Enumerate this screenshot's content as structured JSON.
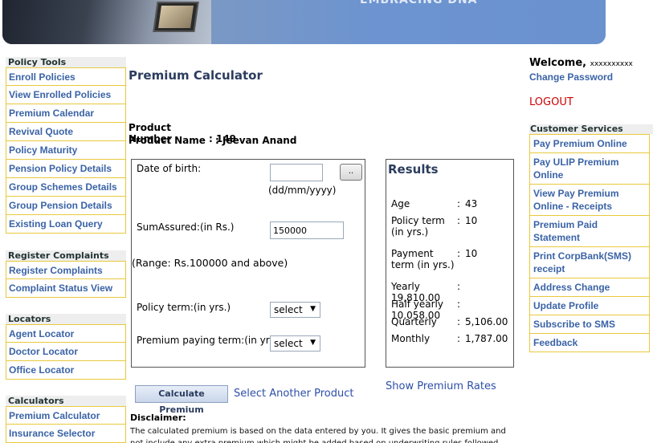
{
  "banner": {
    "tag": "EMBRACING DNA"
  },
  "left_nav": {
    "sections": [
      {
        "heading": "Policy Tools",
        "items": [
          "Enroll Policies",
          "View Enrolled Policies",
          "Premium Calendar",
          "Revival Quote",
          "Policy Maturity",
          "Pension Policy Details",
          "Group Schemes Details",
          "Group Pension Details",
          "Existing Loan Query"
        ]
      },
      {
        "heading": "Register Complaints",
        "items": [
          "Register Complaints",
          "Complaint Status View"
        ]
      },
      {
        "heading": "Locators",
        "items": [
          "Agent Locator",
          "Doctor Locator",
          "Office Locator"
        ]
      },
      {
        "heading": "Calculators",
        "items": [
          "Premium Calculator",
          "Insurance Selector"
        ]
      }
    ]
  },
  "main": {
    "title": "Premium Calculator",
    "product_number_label": "Product Number",
    "product_number": ": 149",
    "product_name_label": "Product Name",
    "product_name": ": Jeevan Anand"
  },
  "form": {
    "dob_label": "Date of birth:",
    "dob_value": "",
    "dob_button": "..",
    "dob_hint": "(dd/mm/yyyy)",
    "sum_label": "SumAssured:(in Rs.)",
    "sum_value": "150000",
    "range_note": "(Range: Rs.100000 and above)",
    "policy_term_label": "Policy term:(in yrs.)",
    "policy_term_value": "select",
    "premium_term_label": "Premium paying term:(in yrs.)",
    "premium_term_value": "select"
  },
  "results": {
    "title": "Results",
    "rows": [
      {
        "key": "Age",
        "value": "43"
      },
      {
        "key": "Policy term (in yrs.)",
        "value": "10"
      },
      {
        "key": "Payment term (in yrs.)",
        "value": "10"
      },
      {
        "key": "Yearly",
        "value": "19,810.00"
      },
      {
        "key": "Half yearly",
        "value": "10,058.00"
      },
      {
        "key": "Quarterly",
        "value": "5,106.00"
      },
      {
        "key": "Monthly",
        "value": "1,787.00"
      }
    ]
  },
  "actions": {
    "calculate": "Calculate Premium",
    "select_another": "Select Another Product",
    "show_rates": "Show Premium Rates"
  },
  "disclaimer": {
    "heading": "Disclaimer:",
    "text": "The calculated premium is based on the data entered by you. It gives the basic premium and not include any extra premium which might be added based on underwriting rules followed by LIC."
  },
  "right": {
    "welcome": "Welcome,",
    "user": "xxxxxxxxxx",
    "change_password": "Change Password",
    "logout": "LOGOUT",
    "services_heading": "Customer Services",
    "services": [
      "Pay Premium Online",
      "Pay ULIP Premium Online",
      "View Pay Premium Online - Receipts",
      "Premium Paid Statement",
      "Print CorpBank(SMS) receipt",
      "Address Change",
      "Update Profile",
      "Subscribe to SMS",
      "Feedback"
    ]
  },
  "colors": {
    "link": "#3a63a6",
    "logout": "#cc0000",
    "border_gold": "#e8c93d",
    "title": "#2b3c5e"
  }
}
